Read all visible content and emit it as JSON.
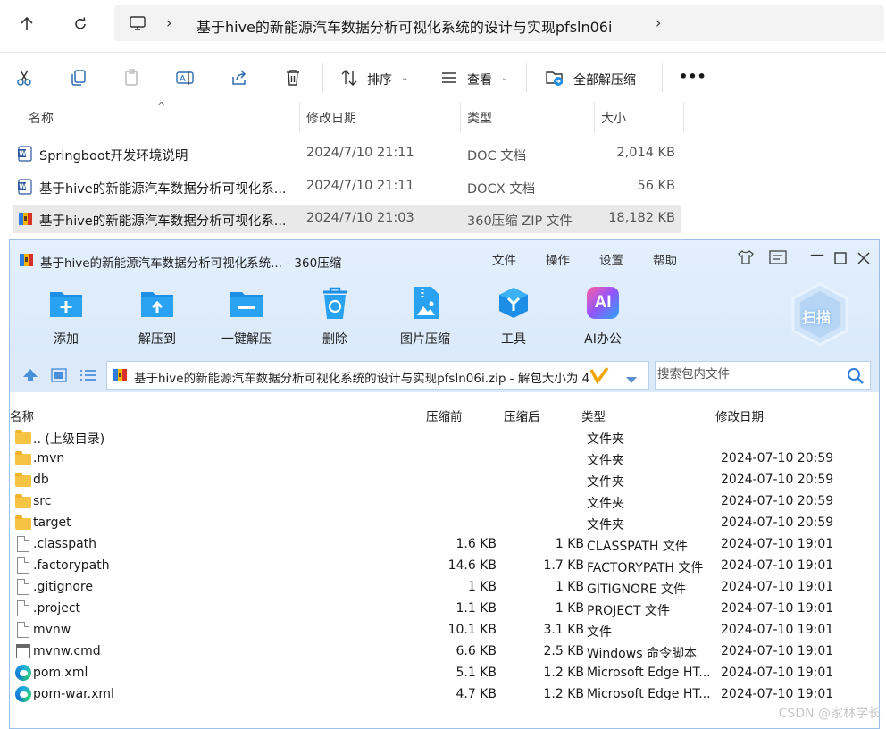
{
  "explorer": {
    "address": "基于hive的新能源汽车数据分析可视化系统的设计与实现pfsln06i",
    "toolbar": {
      "sort_label": "排序",
      "view_label": "查看",
      "extract_all_label": "全部解压缩",
      "more_label": "•••"
    },
    "columns": {
      "name": "名称",
      "date": "修改日期",
      "type": "类型",
      "size": "大小"
    },
    "files": [
      {
        "name": "Springboot开发环境说明",
        "date": "2024/7/10 21:11",
        "type": "DOC 文档",
        "size": "2,014 KB",
        "icon": "word-doc-icon"
      },
      {
        "name": "基于hive的新能源汽车数据分析可视化系...",
        "date": "2024/7/10 21:11",
        "type": "DOCX 文档",
        "size": "56 KB",
        "icon": "word-docx-icon"
      },
      {
        "name": "基于hive的新能源汽车数据分析可视化系...",
        "date": "2024/7/10 21:03",
        "type": "360压缩 ZIP 文件",
        "size": "18,182 KB",
        "icon": "zip-archive-icon"
      }
    ]
  },
  "zip_window": {
    "title": "基于hive的新能源汽车数据分析可视化系统... - 360压缩",
    "menu": [
      "文件",
      "操作",
      "设置",
      "帮助"
    ],
    "tools": [
      "添加",
      "解压到",
      "一键解压",
      "删除",
      "图片压缩",
      "工具",
      "AI办公"
    ],
    "ai_badge": "AI",
    "scan_label": "扫描",
    "path": "基于hive的新能源汽车数据分析可视化系统的设计与实现pfsln06i.zip - 解包大小为 4",
    "search_placeholder": "搜索包内文件",
    "columns": {
      "name": "名称",
      "before": "压缩前",
      "after": "压缩后",
      "type": "类型",
      "date": "修改日期"
    },
    "rows": [
      {
        "name": ".. (上级目录)",
        "before": "",
        "after": "",
        "type": "文件夹",
        "date": "",
        "icon": "folder"
      },
      {
        "name": ".mvn",
        "before": "",
        "after": "",
        "type": "文件夹",
        "date": "2024-07-10 20:59",
        "icon": "folder"
      },
      {
        "name": "db",
        "before": "",
        "after": "",
        "type": "文件夹",
        "date": "2024-07-10 20:59",
        "icon": "folder"
      },
      {
        "name": "src",
        "before": "",
        "after": "",
        "type": "文件夹",
        "date": "2024-07-10 20:59",
        "icon": "folder"
      },
      {
        "name": "target",
        "before": "",
        "after": "",
        "type": "文件夹",
        "date": "2024-07-10 20:59",
        "icon": "folder"
      },
      {
        "name": ".classpath",
        "before": "1.6 KB",
        "after": "1 KB",
        "type": "CLASSPATH 文件",
        "date": "2024-07-10 19:01",
        "icon": "file"
      },
      {
        "name": ".factorypath",
        "before": "14.6 KB",
        "after": "1.7 KB",
        "type": "FACTORYPATH 文件",
        "date": "2024-07-10 19:01",
        "icon": "file"
      },
      {
        "name": ".gitignore",
        "before": "1 KB",
        "after": "1 KB",
        "type": "GITIGNORE 文件",
        "date": "2024-07-10 19:01",
        "icon": "file"
      },
      {
        "name": ".project",
        "before": "1.1 KB",
        "after": "1 KB",
        "type": "PROJECT 文件",
        "date": "2024-07-10 19:01",
        "icon": "file"
      },
      {
        "name": "mvnw",
        "before": "10.1 KB",
        "after": "3.1 KB",
        "type": "文件",
        "date": "2024-07-10 19:01",
        "icon": "file"
      },
      {
        "name": "mvnw.cmd",
        "before": "6.6 KB",
        "after": "2.5 KB",
        "type": "Windows 命令脚本",
        "date": "2024-07-10 19:01",
        "icon": "cmd"
      },
      {
        "name": "pom.xml",
        "before": "5.1 KB",
        "after": "1.2 KB",
        "type": "Microsoft Edge HT...",
        "date": "2024-07-10 19:01",
        "icon": "edge"
      },
      {
        "name": "pom-war.xml",
        "before": "4.7 KB",
        "after": "1.2 KB",
        "type": "Microsoft Edge HT...",
        "date": "2024-07-10 19:01",
        "icon": "edge"
      }
    ]
  },
  "watermark": "CSDN @家林学长",
  "colors": {
    "zip_header_bg": "#e3effc",
    "accent_blue": "#1c8ee6",
    "selected_row": "#e9e9e9"
  }
}
